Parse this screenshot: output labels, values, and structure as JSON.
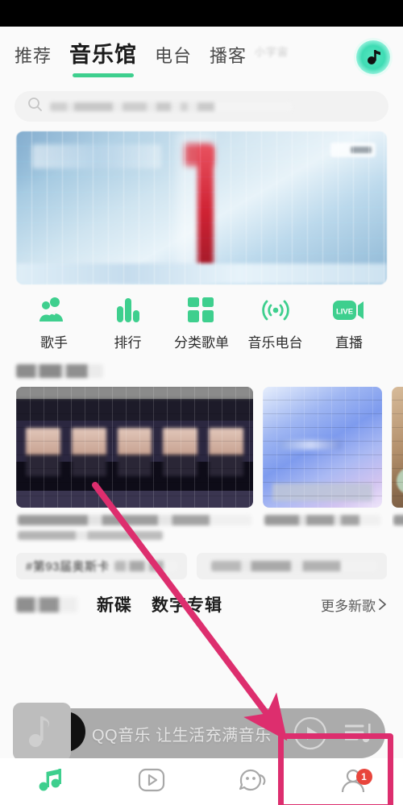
{
  "app": {
    "name": "QQ音乐"
  },
  "statusbar": {
    "visible": true
  },
  "topbar": {
    "tabs": [
      {
        "label": "推荐",
        "active": false
      },
      {
        "label": "音乐馆",
        "active": true
      },
      {
        "label": "电台",
        "active": false
      },
      {
        "label": "播客",
        "active": false
      }
    ],
    "side_label": "小宇宙",
    "logo_icon": "qq-music-note-logo"
  },
  "search": {
    "icon": "search-icon",
    "placeholder": "",
    "value": ""
  },
  "banner": {
    "icon": "banner-image",
    "badge_label": ""
  },
  "categories": [
    {
      "label": "歌手",
      "icon": "singer-icon"
    },
    {
      "label": "排行",
      "icon": "chart-bars-icon"
    },
    {
      "label": "分类歌单",
      "icon": "grid-squares-icon"
    },
    {
      "label": "音乐电台",
      "icon": "radio-wave-icon"
    },
    {
      "label": "直播",
      "icon": "live-camera-icon"
    }
  ],
  "recommend_section": {
    "title": "",
    "cards": [
      {
        "title": "",
        "subtitle": "",
        "thumb": "mv-group-thumb"
      },
      {
        "title": "",
        "subtitle": "",
        "thumb": "blue-playlist-thumb"
      },
      {
        "title": "",
        "subtitle": "",
        "thumb": "cut-off-thumb"
      }
    ]
  },
  "tags": [
    {
      "label": "#第93届奥斯卡"
    },
    {
      "label": ""
    }
  ],
  "new_release": {
    "lead_blur": "",
    "items": [
      "新碟",
      "数字专辑"
    ],
    "more_label": "更多新歌",
    "more_icon": "chevron-right-icon"
  },
  "player": {
    "title": "QQ音乐 让生活充满音乐",
    "art_icon": "music-note-art-icon",
    "play_icon": "play-circle-icon",
    "playlist_icon": "playlist-icon"
  },
  "bottomnav": {
    "items": [
      {
        "icon": "music-note-icon",
        "active": true,
        "badge": ""
      },
      {
        "icon": "video-play-icon",
        "active": false,
        "badge": ""
      },
      {
        "icon": "social-face-icon",
        "active": false,
        "badge": ""
      },
      {
        "icon": "profile-icon",
        "active": false,
        "badge": "1"
      }
    ]
  },
  "annotations": {
    "arrow": {
      "color": "#dd2e6e",
      "from": [
        118,
        602
      ],
      "to": [
        345,
        900
      ]
    },
    "highlight_box": {
      "color": "#dd2e6e"
    }
  },
  "colors": {
    "accent_green": "#3ecf8e",
    "annotation_pink": "#dd2e6e",
    "badge_red": "#e8453c",
    "text_primary": "#1b1b1b"
  }
}
